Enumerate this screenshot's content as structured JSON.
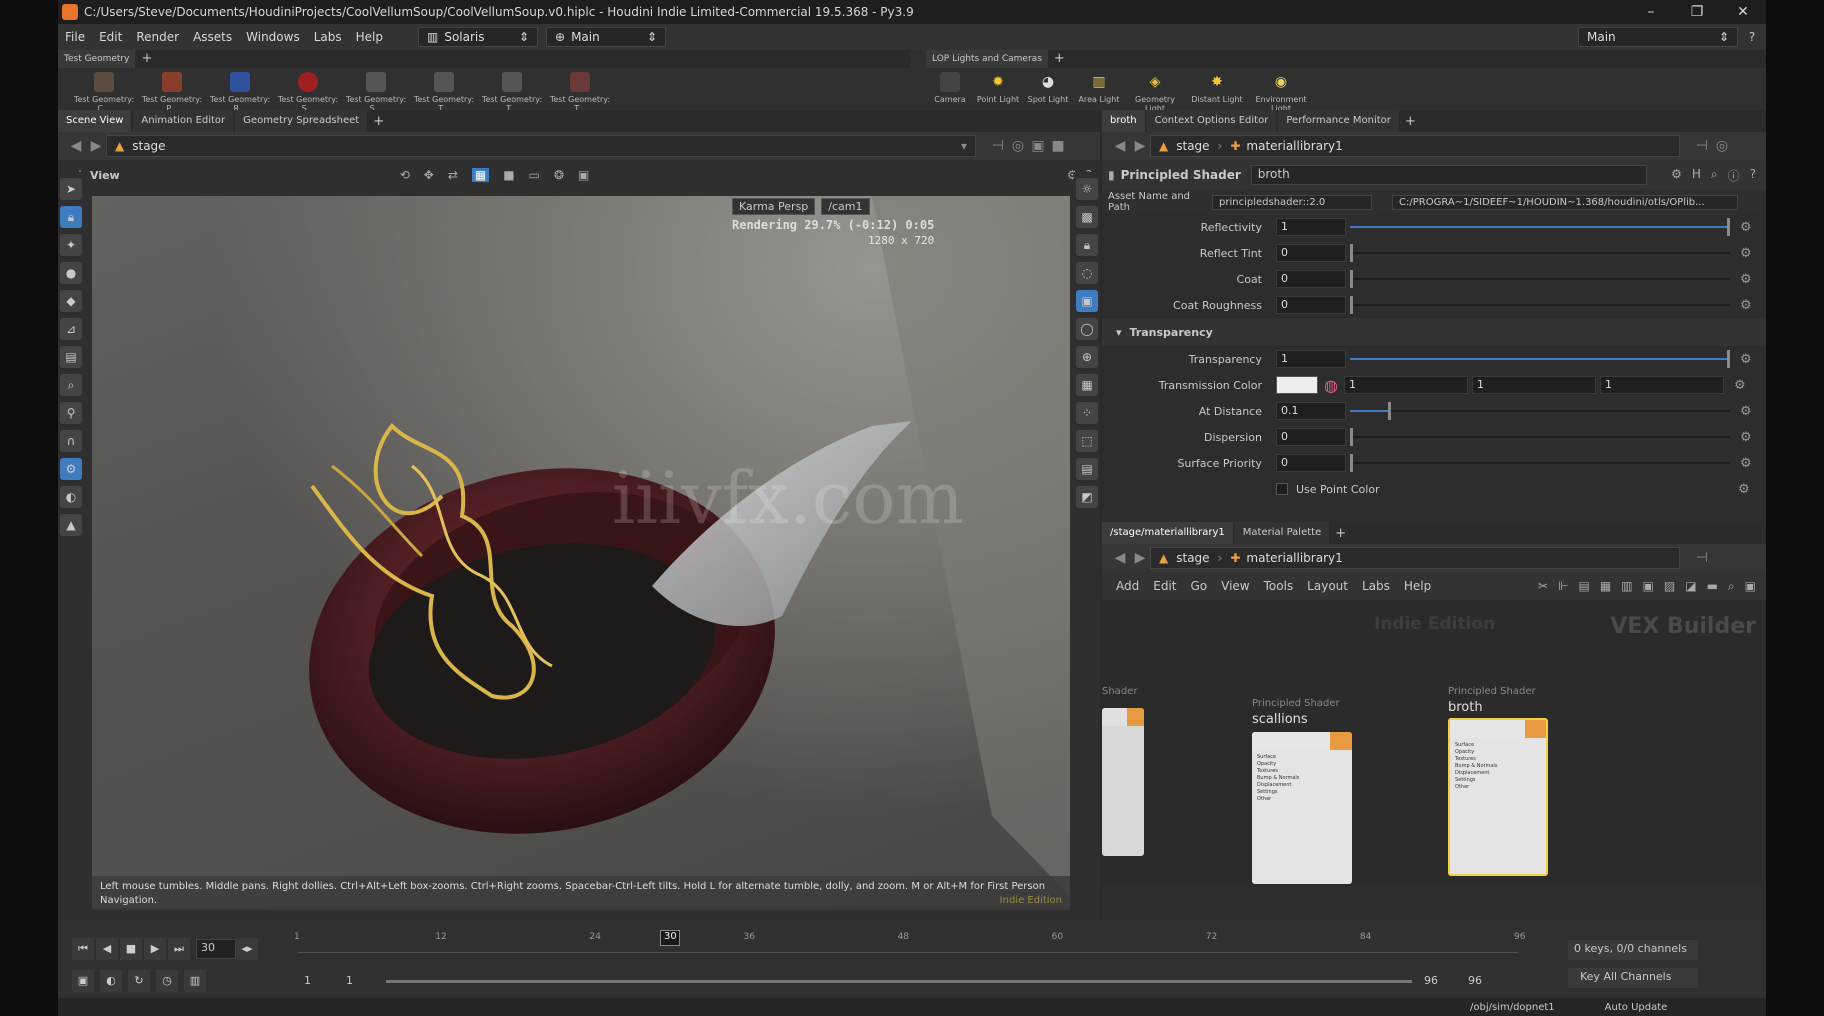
{
  "titlebar": {
    "title": "C:/Users/Steve/Documents/HoudiniProjects/CoolVellumSoup/CoolVellumSoup.v0.hiplc - Houdini Indie Limited-Commercial 19.5.368 - Py3.9"
  },
  "menubar": {
    "items": [
      "File",
      "Edit",
      "Render",
      "Assets",
      "Windows",
      "Labs",
      "Help"
    ],
    "desktop": "Solaris",
    "context": "Main",
    "right_desktop": "Main"
  },
  "shelf_left": {
    "tab": "Test Geometry",
    "tools": [
      "Test Geometry: C...",
      "Test Geometry: P...",
      "Test Geometry: R...",
      "Test Geometry: S...",
      "Test Geometry: S...",
      "Test Geometry: T...",
      "Test Geometry: T...",
      "Test Geometry: T..."
    ]
  },
  "shelf_right": {
    "tab": "LOP Lights and Cameras",
    "tools": [
      "Camera",
      "Point Light",
      "Spot Light",
      "Area Light",
      "Geometry Light",
      "Distant Light",
      "Environment Light"
    ]
  },
  "left_tabs": [
    "Scene View",
    "Animation Editor",
    "Geometry Spreadsheet"
  ],
  "left_path": "stage",
  "viewport": {
    "title": "View",
    "renderer": "Karma Persp",
    "camera": "/cam1",
    "render_status": "Rendering   29.7%  (-0:12)  0:05",
    "resolution": "1280 x 720",
    "watermark": "iiivfx.com",
    "status_msg": "Left mouse tumbles. Middle pans. Right dollies. Ctrl+Alt+Left box-zooms. Ctrl+Right zooms. Spacebar-Ctrl-Left tilts. Hold L for alternate tumble, dolly, and zoom.    M or Alt+M for First Person Navigation.",
    "edition": "Indie Edition"
  },
  "right_tabs": [
    "broth",
    "Context Options Editor",
    "Performance Monitor"
  ],
  "right_path": {
    "root": "stage",
    "node": "materiallibrary1"
  },
  "params": {
    "node_type": "Principled Shader",
    "node_name": "broth",
    "asset_label": "Asset Name and Path",
    "asset_name": "principledshader::2.0",
    "asset_path": "C:/PROGRA~1/SIDEEF~1/HOUDIN~1.368/houdini/otls/OPlib...",
    "rows_top": [
      {
        "label": "Reflectivity",
        "value": "1",
        "fill": 1.0
      },
      {
        "label": "Reflect Tint",
        "value": "0",
        "fill": 0.0
      },
      {
        "label": "Coat",
        "value": "0",
        "fill": 0.0
      },
      {
        "label": "Coat Roughness",
        "value": "0",
        "fill": 0.0
      }
    ],
    "section": "Transparency",
    "rows_trans": [
      {
        "label": "Transparency",
        "value": "1",
        "fill": 1.0
      }
    ],
    "transmission": {
      "label": "Transmission Color",
      "r": "1",
      "g": "1",
      "b": "1"
    },
    "rows_trans2": [
      {
        "label": "At Distance",
        "value": "0.1",
        "fill": 0.1
      },
      {
        "label": "Dispersion",
        "value": "0",
        "fill": 0.0
      },
      {
        "label": "Surface Priority",
        "value": "0",
        "fill": 0.0
      }
    ],
    "use_point_color": "Use Point Color"
  },
  "network": {
    "tabs": [
      "/stage/materiallibrary1",
      "Material Palette"
    ],
    "path_root": "stage",
    "path_node": "materiallibrary1",
    "menu": [
      "Add",
      "Edit",
      "Go",
      "View",
      "Tools",
      "Layout",
      "Labs",
      "Help"
    ],
    "edition": "Indie Edition",
    "context_label": "VEX Builder",
    "nodes": [
      {
        "type": "Shader",
        "name": ""
      },
      {
        "type": "Principled Shader",
        "name": "scallions"
      },
      {
        "type": "Principled Shader",
        "name": "broth"
      }
    ],
    "port_lines": [
      "Surface",
      "Opacity",
      "Textures",
      "Bump & Normals",
      "Displacement",
      "Settings",
      "Other"
    ]
  },
  "timeline": {
    "current_frame": "30",
    "marker": "30",
    "ticks": [
      "1",
      "12",
      "24",
      "36",
      "48",
      "60",
      "72",
      "84",
      "96"
    ],
    "start": "1",
    "start2": "1",
    "end": "96",
    "end2": "96",
    "keys": "0 keys, 0/0 channels",
    "key_all": "Key All Channels",
    "path": "/obj/sim/dopnet1",
    "update": "Auto Update"
  }
}
